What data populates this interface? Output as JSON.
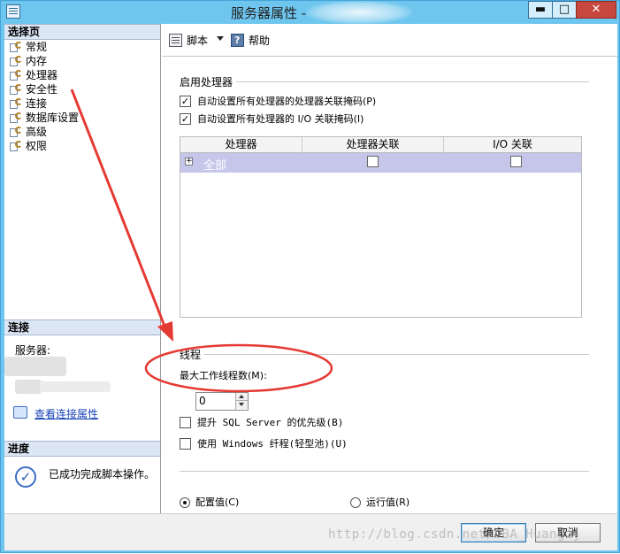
{
  "window": {
    "title": "服务器属性 -",
    "minimize": "▬",
    "maximize": "□",
    "close": "✕"
  },
  "sidebar": {
    "header": "选择页",
    "items": [
      {
        "label": "常规"
      },
      {
        "label": "内存"
      },
      {
        "label": "处理器"
      },
      {
        "label": "安全性"
      },
      {
        "label": "连接"
      },
      {
        "label": "数据库设置"
      },
      {
        "label": "高级"
      },
      {
        "label": "权限"
      }
    ]
  },
  "connection": {
    "header": "连接",
    "server_label": "服务器:",
    "link": "查看连接属性"
  },
  "progress": {
    "header": "进度",
    "status": "已成功完成脚本操作。"
  },
  "toolbar": {
    "script": "脚本",
    "help": "帮助"
  },
  "processor": {
    "group_label": "启用处理器",
    "auto_affinity": "自动设置所有处理器的处理器关联掩码(P)",
    "auto_io_affinity": "自动设置所有处理器的 I/O 关联掩码(I)",
    "table": {
      "columns": [
        "处理器",
        "处理器关联",
        "I/O 关联"
      ],
      "rows": [
        {
          "label": "全部",
          "affinity": false,
          "io_affinity": false
        }
      ]
    }
  },
  "threads": {
    "group_label": "线程",
    "max_worker_label": "最大工作线程数(M):",
    "max_worker_value": "0",
    "boost_priority": "提升 SQL Server 的优先级(B)",
    "use_fibers": "使用 Windows 纤程(轻型池)(U)"
  },
  "values": {
    "configured": "配置值(C)",
    "running": "运行值(R)"
  },
  "buttons": {
    "ok": "确定",
    "cancel": "取消"
  },
  "watermark": "http://blog.csdn.net/DBA_Huangzj",
  "colors": {
    "titlebar": "#6ec6ee",
    "annotation": "#e53a33",
    "row_highlight": "#c6c6ea"
  }
}
